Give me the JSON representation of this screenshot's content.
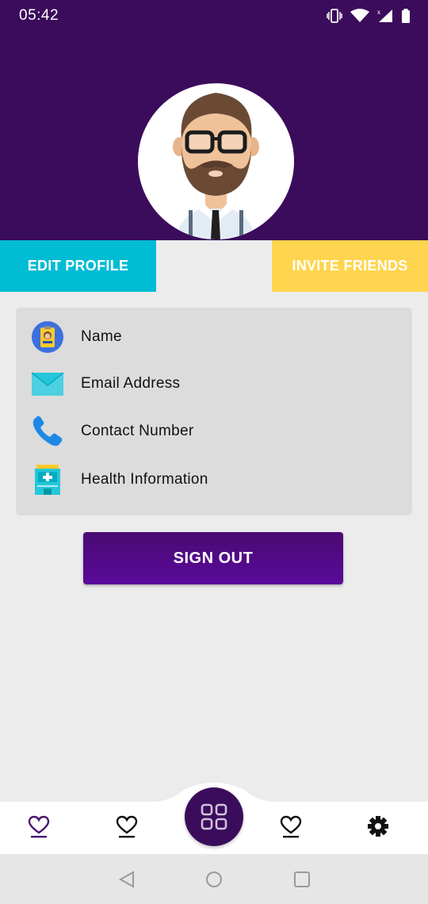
{
  "status_bar": {
    "time": "05:42",
    "icons": [
      "vibrate-icon",
      "wifi-icon",
      "cell-signal-icon",
      "battery-icon"
    ]
  },
  "profile": {
    "avatar": "bearded-man-avatar"
  },
  "actions": {
    "edit_profile": "EDIT PROFILE",
    "invite_friends": "INVITE FRIENDS"
  },
  "info": {
    "items": [
      {
        "label": "Name",
        "icon": "id-card-icon"
      },
      {
        "label": "Email Address",
        "icon": "envelope-icon"
      },
      {
        "label": "Contact Number",
        "icon": "phone-icon"
      },
      {
        "label": "Health Information",
        "icon": "hospital-icon"
      }
    ]
  },
  "sign_out_label": "SIGN OUT",
  "bottom_nav": {
    "items": [
      "heart-icon",
      "heart-icon",
      "grid-icon",
      "heart-icon",
      "gear-icon"
    ],
    "active_index": 0
  },
  "colors": {
    "header": "#3b0c5c",
    "edit_button": "#00bcd4",
    "invite_button": "#ffd54f",
    "sign_out": "#4a0a72"
  }
}
